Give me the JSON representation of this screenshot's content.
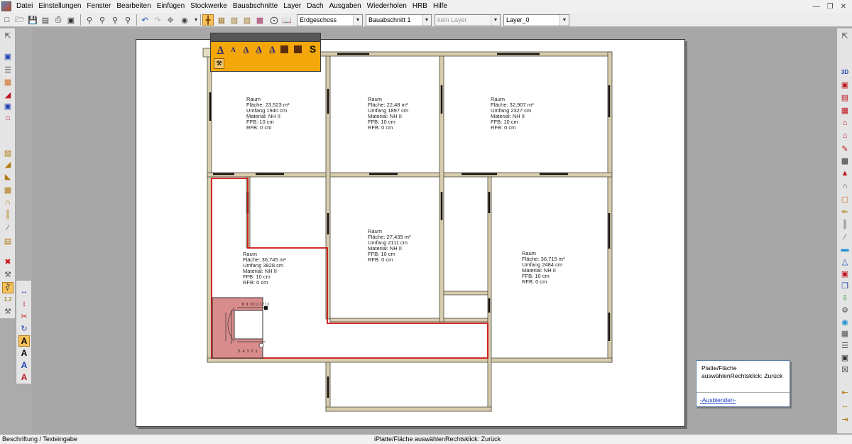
{
  "menu": {
    "items": [
      "Datei",
      "Einstellungen",
      "Fenster",
      "Bearbeiten",
      "Einfügen",
      "Stockwerke",
      "Bauabschnitte",
      "Layer",
      "Dach",
      "Ausgaben",
      "Wiederholen",
      "HRB",
      "Hilfe"
    ]
  },
  "toolbar": {
    "floor_select": "Erdgeschoss",
    "section_select": "Bauabschnitt 1",
    "layer_filter_select": "kein Layer",
    "layer_select": "Layer_0"
  },
  "floating_toolbar": {
    "s_label": "S"
  },
  "plan": {
    "rooms": [
      {
        "name": "Raum",
        "area": "Fläche: 23,523 m²",
        "perimeter": "Umfang 1940 cm",
        "material": "Material: NH II",
        "ffb": "FFB: 10 cm",
        "rfb": "RFB: 0 cm"
      },
      {
        "name": "Raum",
        "area": "Fläche: 22,48 m²",
        "perimeter": "Umfang 1897 cm",
        "material": "Material: NH II",
        "ffb": "FFB: 10 cm",
        "rfb": "RFB: 0 cm"
      },
      {
        "name": "Raum",
        "area": "Fläche: 32,907 m²",
        "perimeter": "Umfang 2327 cm",
        "material": "Material: NH II",
        "ffb": "FFB: 10 cm",
        "rfb": "RFB: 0 cm"
      },
      {
        "name": "Raum",
        "area": "Fläche: 27,439 m²",
        "perimeter": "Umfang 2111 cm",
        "material": "Material: NH II",
        "ffb": "FFB: 10 cm",
        "rfb": "RFB: 0 cm"
      },
      {
        "name": "Raum",
        "area": "Fläche: 36,745 m²",
        "perimeter": "Umfang 3828 cm",
        "material": "Material: NH II",
        "ffb": "FFB: 10 cm",
        "rfb": "RFB: 0 cm"
      },
      {
        "name": "Raum",
        "area": "Fläche: 36,715 m²",
        "perimeter": "Umfang 2484 cm",
        "material": "Material: NH II",
        "ffb": "FFB: 10 cm",
        "rfb": "RFB: 0 cm"
      }
    ],
    "stair_steps_top": [
      "8",
      "9",
      "10",
      "11",
      "12",
      "13"
    ],
    "stair_steps_bottom": [
      "5",
      "4",
      "3",
      "2",
      "1"
    ]
  },
  "tip": {
    "line1": "Platte/Fläche",
    "line2": "auswählenRechtsklick: Zurück",
    "link": "-Ausblenden-"
  },
  "status": {
    "left": "Beschriftung / Texteingabe",
    "center": "iPlatte/Fläche auswählenRechtsklick: Zurück"
  },
  "colors": {
    "accent": "#f3a70b",
    "wall": "#d8ccae",
    "selection": "#cc1111",
    "stair_fill": "#d98c8c"
  }
}
